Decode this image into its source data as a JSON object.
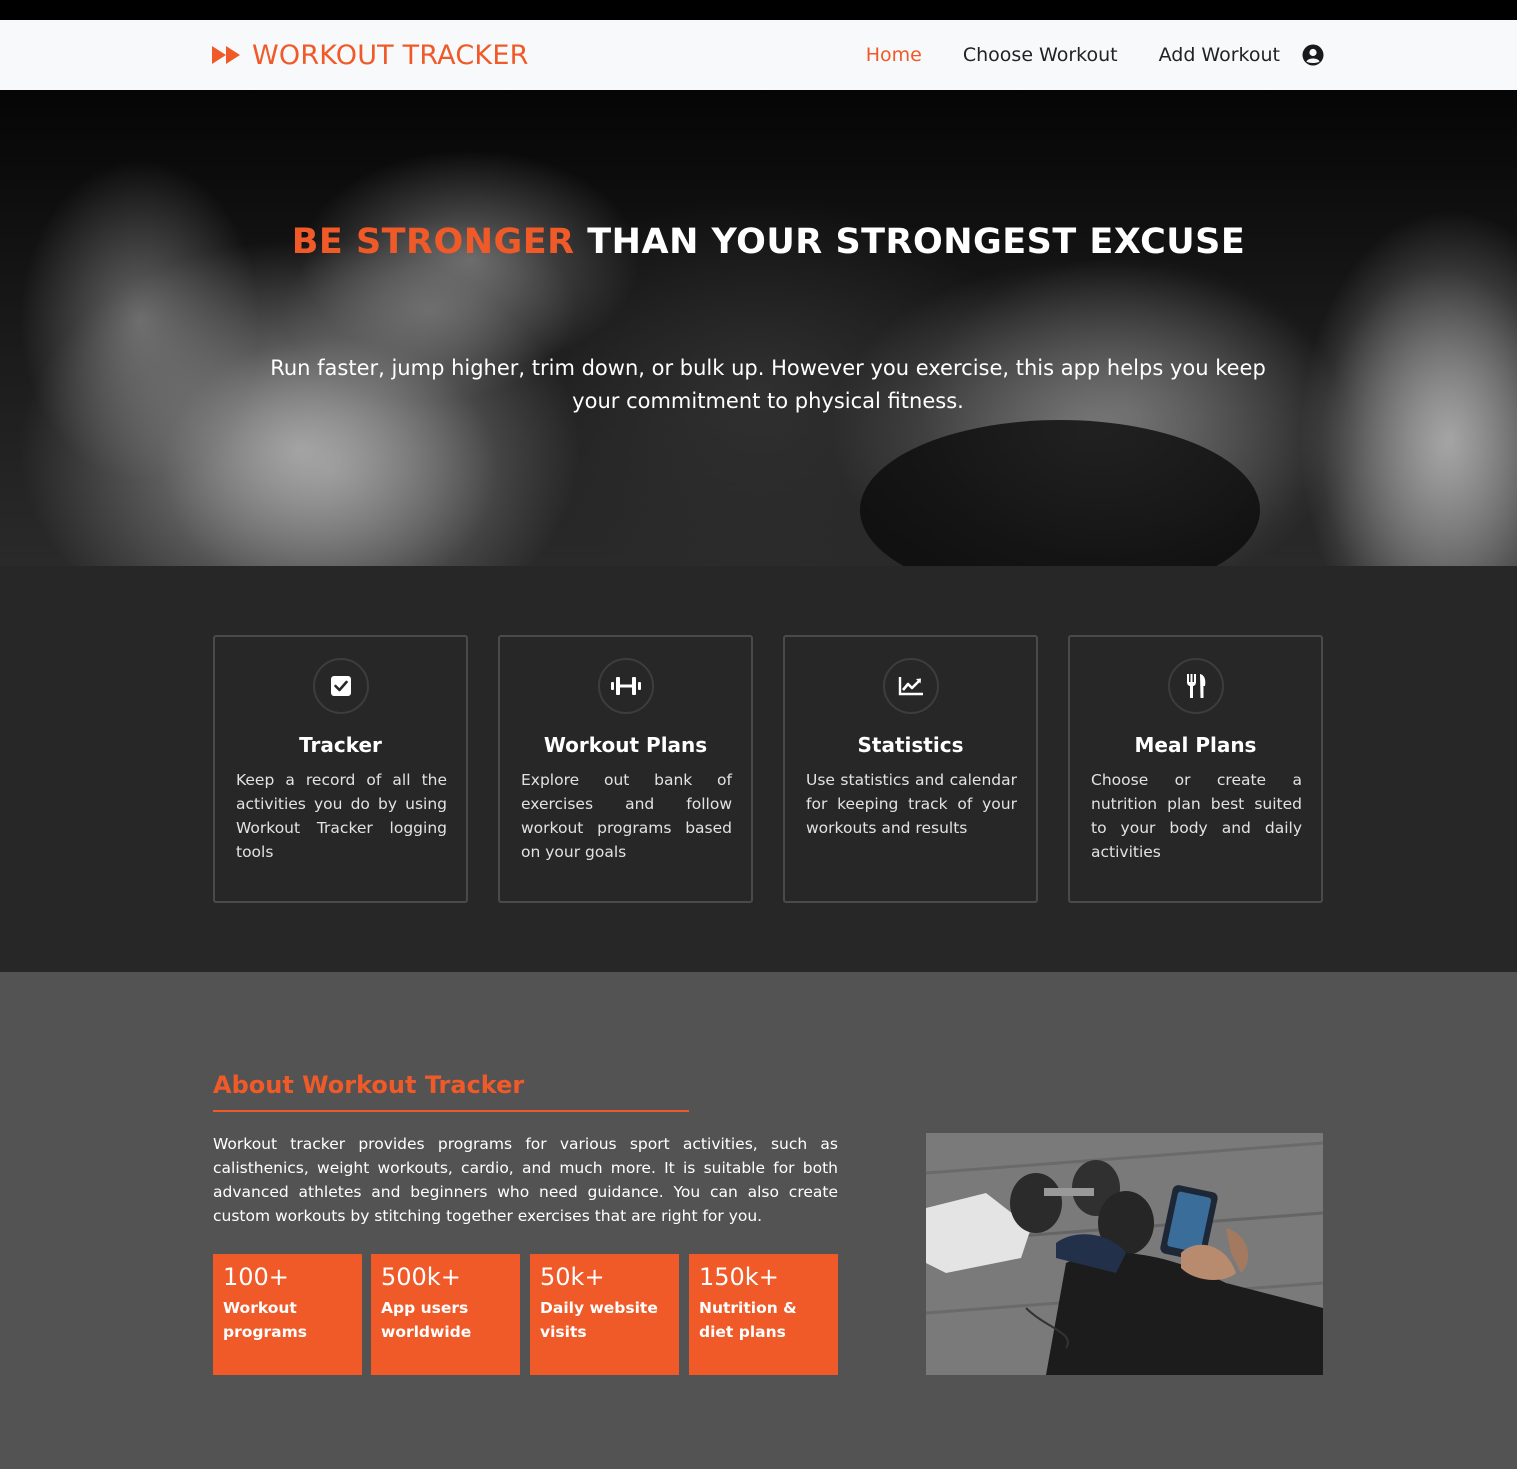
{
  "brand": {
    "name": "WORKOUT TRACKER",
    "color": "#f05a28"
  },
  "nav": {
    "items": [
      {
        "label": "Home",
        "active": true
      },
      {
        "label": "Choose Workout",
        "active": false
      },
      {
        "label": "Add Workout",
        "active": false
      }
    ],
    "account_icon": "user-circle-icon"
  },
  "hero": {
    "title_accent": "BE STRONGER",
    "title_rest": " THAN YOUR STRONGEST EXCUSE",
    "subtitle": "Run faster, jump higher, trim down, or bulk up. However you exercise, this app helps you keep your commitment to physical fitness."
  },
  "features": [
    {
      "icon": "check-square-icon",
      "title": "Tracker",
      "description": "Keep a record of all the activities you do by using Workout Tracker logging tools"
    },
    {
      "icon": "dumbbell-icon",
      "title": "Workout Plans",
      "description": "Explore out bank of exercises and follow workout programs based on your goals"
    },
    {
      "icon": "chart-line-icon",
      "title": "Statistics",
      "description": "Use statistics and calendar for keeping track of your workouts and results"
    },
    {
      "icon": "utensils-icon",
      "title": "Meal Plans",
      "description": "Choose or create a nutrition plan best suited to your body and daily activities"
    }
  ],
  "about": {
    "title": "About Workout Tracker",
    "text": "Workout tracker provides programs for various sport activities, such as calisthenics, weight workouts, cardio, and much more. It is suitable for both advanced athletes and beginners who need guidance. You can also create custom workouts by stitching together exercises that are right for you.",
    "stats": [
      {
        "value": "100+",
        "label": "Workout programs"
      },
      {
        "value": "500k+",
        "label": "App users worldwide"
      },
      {
        "value": "50k+",
        "label": "Daily website visits"
      },
      {
        "value": "150k+",
        "label": "Nutrition & diet plans"
      }
    ]
  },
  "colors": {
    "accent": "#f05a28",
    "nav_bg": "#f8f9fa",
    "features_bg": "#272727",
    "about_bg": "#535353"
  }
}
